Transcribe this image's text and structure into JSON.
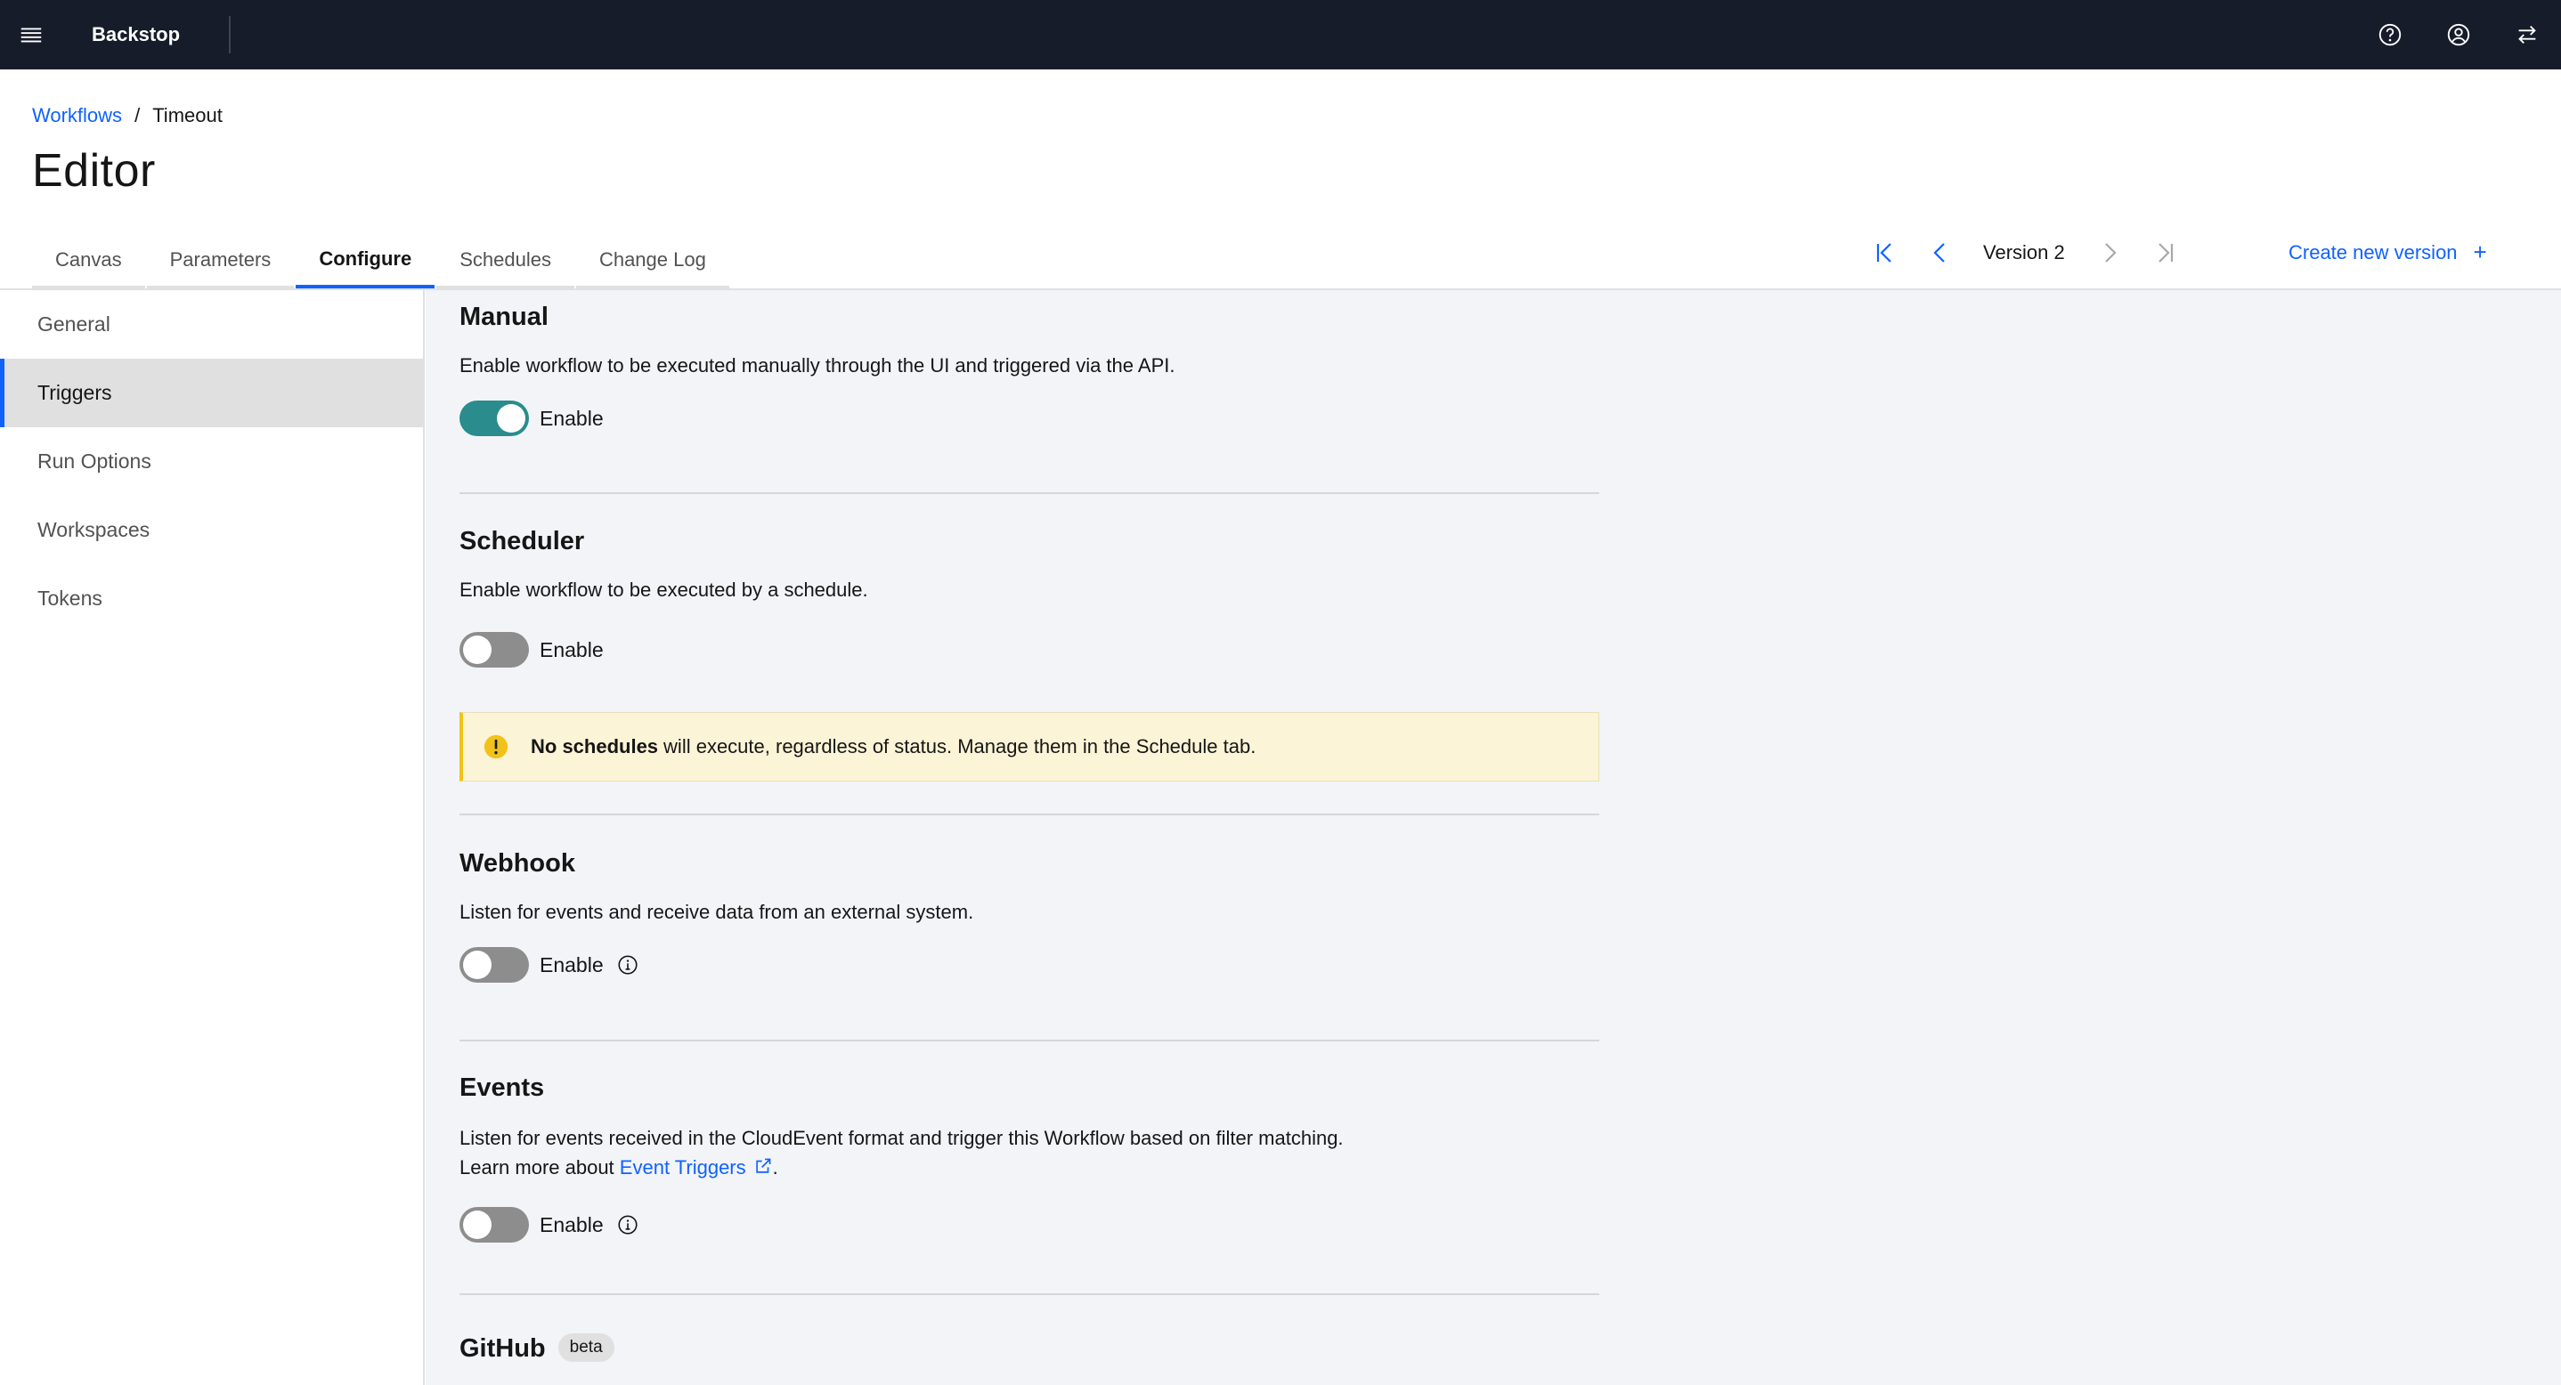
{
  "app": {
    "name": "Backstop",
    "icons": {
      "menu": "hamburger-icon",
      "help": "help-icon",
      "user": "user-avatar-icon",
      "switch": "switcher-icon"
    }
  },
  "breadcrumb": {
    "parent": "Workflows",
    "separator": "/",
    "current": "Timeout"
  },
  "page": {
    "title": "Editor"
  },
  "tabs": [
    {
      "label": "Canvas",
      "active": false
    },
    {
      "label": "Parameters",
      "active": false
    },
    {
      "label": "Configure",
      "active": true
    },
    {
      "label": "Schedules",
      "active": false
    },
    {
      "label": "Change Log",
      "active": false
    }
  ],
  "version": {
    "label": "Version 2",
    "create_label": "Create new version",
    "create_icon": "+"
  },
  "sidebar": {
    "items": [
      {
        "label": "General",
        "active": false
      },
      {
        "label": "Triggers",
        "active": true
      },
      {
        "label": "Run Options",
        "active": false
      },
      {
        "label": "Workspaces",
        "active": false
      },
      {
        "label": "Tokens",
        "active": false
      }
    ]
  },
  "triggers": {
    "manual": {
      "title": "Manual",
      "description": "Enable workflow to be executed manually through the UI and triggered via the API.",
      "toggle_label": "Enable",
      "enabled": true
    },
    "scheduler": {
      "title": "Scheduler",
      "description": "Enable workflow to be executed by a schedule.",
      "toggle_label": "Enable",
      "enabled": false,
      "notice_bold": "No schedules",
      "notice_text": "will execute, regardless of status. Manage them in the Schedule tab."
    },
    "webhook": {
      "title": "Webhook",
      "description": "Listen for events and receive data from an external system.",
      "toggle_label": "Enable",
      "enabled": false
    },
    "events": {
      "title": "Events",
      "description": "Listen for events received in the CloudEvent format and trigger this Workflow based on filter matching.",
      "learn_more": "Learn more about",
      "link_label": "Event Triggers",
      "trailing": ".",
      "toggle_label": "Enable",
      "enabled": false
    },
    "github": {
      "title": "GitHub",
      "tag": "beta"
    }
  },
  "colors": {
    "topbar": "#161c2a",
    "accent": "#0f62fe",
    "toggle_on": "#2a8c8c",
    "toggle_off": "#8d8d8d",
    "warning": "#f1c21b",
    "warning_bg": "#fcf4d6",
    "main_bg": "#f2f4f8"
  }
}
